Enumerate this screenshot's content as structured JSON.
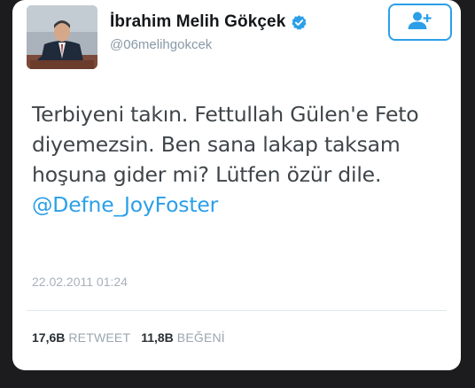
{
  "tweet": {
    "display_name": "İbrahim Melih Gökçek",
    "handle": "@06melihgokcek",
    "verified_icon": "verified-badge-icon",
    "follow_icon": "follow-user-icon",
    "text_parts": [
      "Terbiyeni takın. Fettullah Gülen'e Feto diyemezsin. Ben sana lakap taksam hoşuna gider mi? Lütfen özür dile. ",
      "@Defne_JoyFoster"
    ],
    "timestamp": "22.02.2011 01:24",
    "retweets_count": "17,6B",
    "retweets_label": "RETWEET",
    "likes_count": "11,8B",
    "likes_label": "BEĞENİ"
  },
  "colors": {
    "accent": "#2b9fe8",
    "text": "#3f4549",
    "muted": "#8899a6",
    "background": "#1c1c1e",
    "card": "#ffffff"
  }
}
